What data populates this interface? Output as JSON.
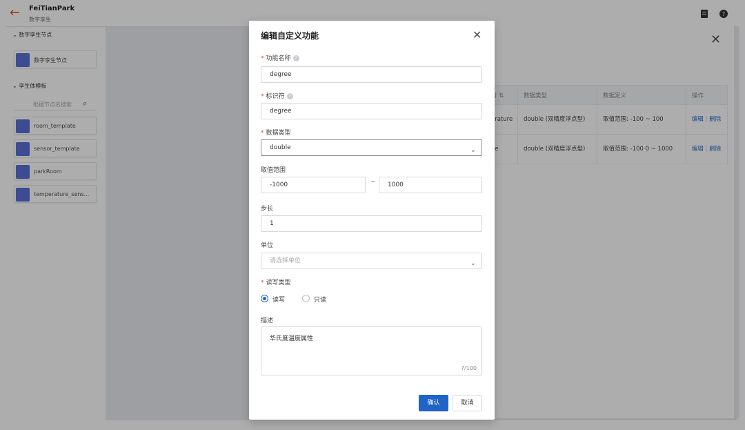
{
  "app": {
    "title": "FeiTianPark",
    "subtitle": "数字孪生"
  },
  "sidebar": {
    "section1_label": "数字孪生节点",
    "node1_label": "数字孪生节点",
    "section2_label": "孪生体模板",
    "search_placeholder": "根据节点名搜索",
    "templates": [
      "room_template",
      "sensor_template",
      "parkRoom",
      "temperature_sens..."
    ]
  },
  "table": {
    "headers": [
      "符 ⇅",
      "数据类型",
      "数据定义",
      "操作"
    ],
    "rows": [
      {
        "id": "erature",
        "type": "double (双精度浮点型)",
        "def": "取值范围: -100 ~ 100",
        "edit": "编辑",
        "del": "删除"
      },
      {
        "id": "ee",
        "type": "double (双精度浮点型)",
        "def": "取值范围: -100 0 ~ 1000",
        "edit": "编辑",
        "del": "删除"
      }
    ]
  },
  "dialog": {
    "title": "编辑自定义功能",
    "name_label": "功能名称",
    "name_value": "degree",
    "identifier_label": "标识符",
    "identifier_value": "degree",
    "datatype_label": "数据类型",
    "datatype_value": "double",
    "range_label": "取值范围",
    "range_min": "-1000",
    "range_sep": "~",
    "range_max": "1000",
    "step_label": "步长",
    "step_value": "1",
    "unit_label": "单位",
    "unit_placeholder": "请选择单位",
    "rw_label": "读写类型",
    "rw_options": [
      "读写",
      "只读"
    ],
    "rw_selected": "读写",
    "desc_label": "描述",
    "desc_value": "华氏度温度属性",
    "desc_counter": "7/100",
    "confirm_label": "确认",
    "cancel_label": "取消"
  },
  "colors": {
    "primary": "#1f63c6",
    "back_arrow": "#e8571c",
    "required": "#e0473d"
  }
}
